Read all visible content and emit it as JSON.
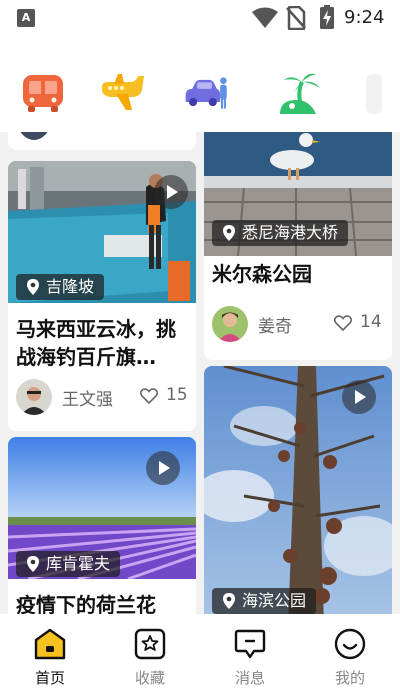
{
  "status_bar": {
    "notification_badge": "A",
    "time": "9:24",
    "icons": [
      "wifi-icon",
      "no-sim-icon",
      "battery-charging-icon"
    ]
  },
  "categories": [
    {
      "icon": "bus-icon",
      "color": "#f0663c"
    },
    {
      "icon": "plane-icon",
      "color": "#f7be22"
    },
    {
      "icon": "car-rental-icon",
      "color": "#6f6ee0"
    },
    {
      "icon": "beach-island-icon",
      "color": "#2fc26b"
    }
  ],
  "feed": {
    "left_column": [
      {
        "location": "吉隆坡",
        "title": "马来西亚云冰，挑战海钓百斤旗…",
        "author": "王文强",
        "likes": "15",
        "has_video": true
      },
      {
        "location": "库肯霍夫",
        "title": "疫情下的荷兰花",
        "has_video": true
      }
    ],
    "right_column": [
      {
        "location": "悉尼海港大桥",
        "title": "米尔森公园",
        "author": "姜奇",
        "likes": "14",
        "has_video": false
      },
      {
        "location": "海滨公园",
        "has_video": true
      }
    ]
  },
  "bottom_nav": [
    {
      "label": "首页",
      "icon": "home-icon",
      "active": true
    },
    {
      "label": "收藏",
      "icon": "favorites-star-icon",
      "active": false
    },
    {
      "label": "消息",
      "icon": "message-icon",
      "active": false
    },
    {
      "label": "我的",
      "icon": "profile-smile-icon",
      "active": false
    }
  ],
  "colors": {
    "accent": "#f7c21e",
    "background": "#f1f1f1"
  }
}
